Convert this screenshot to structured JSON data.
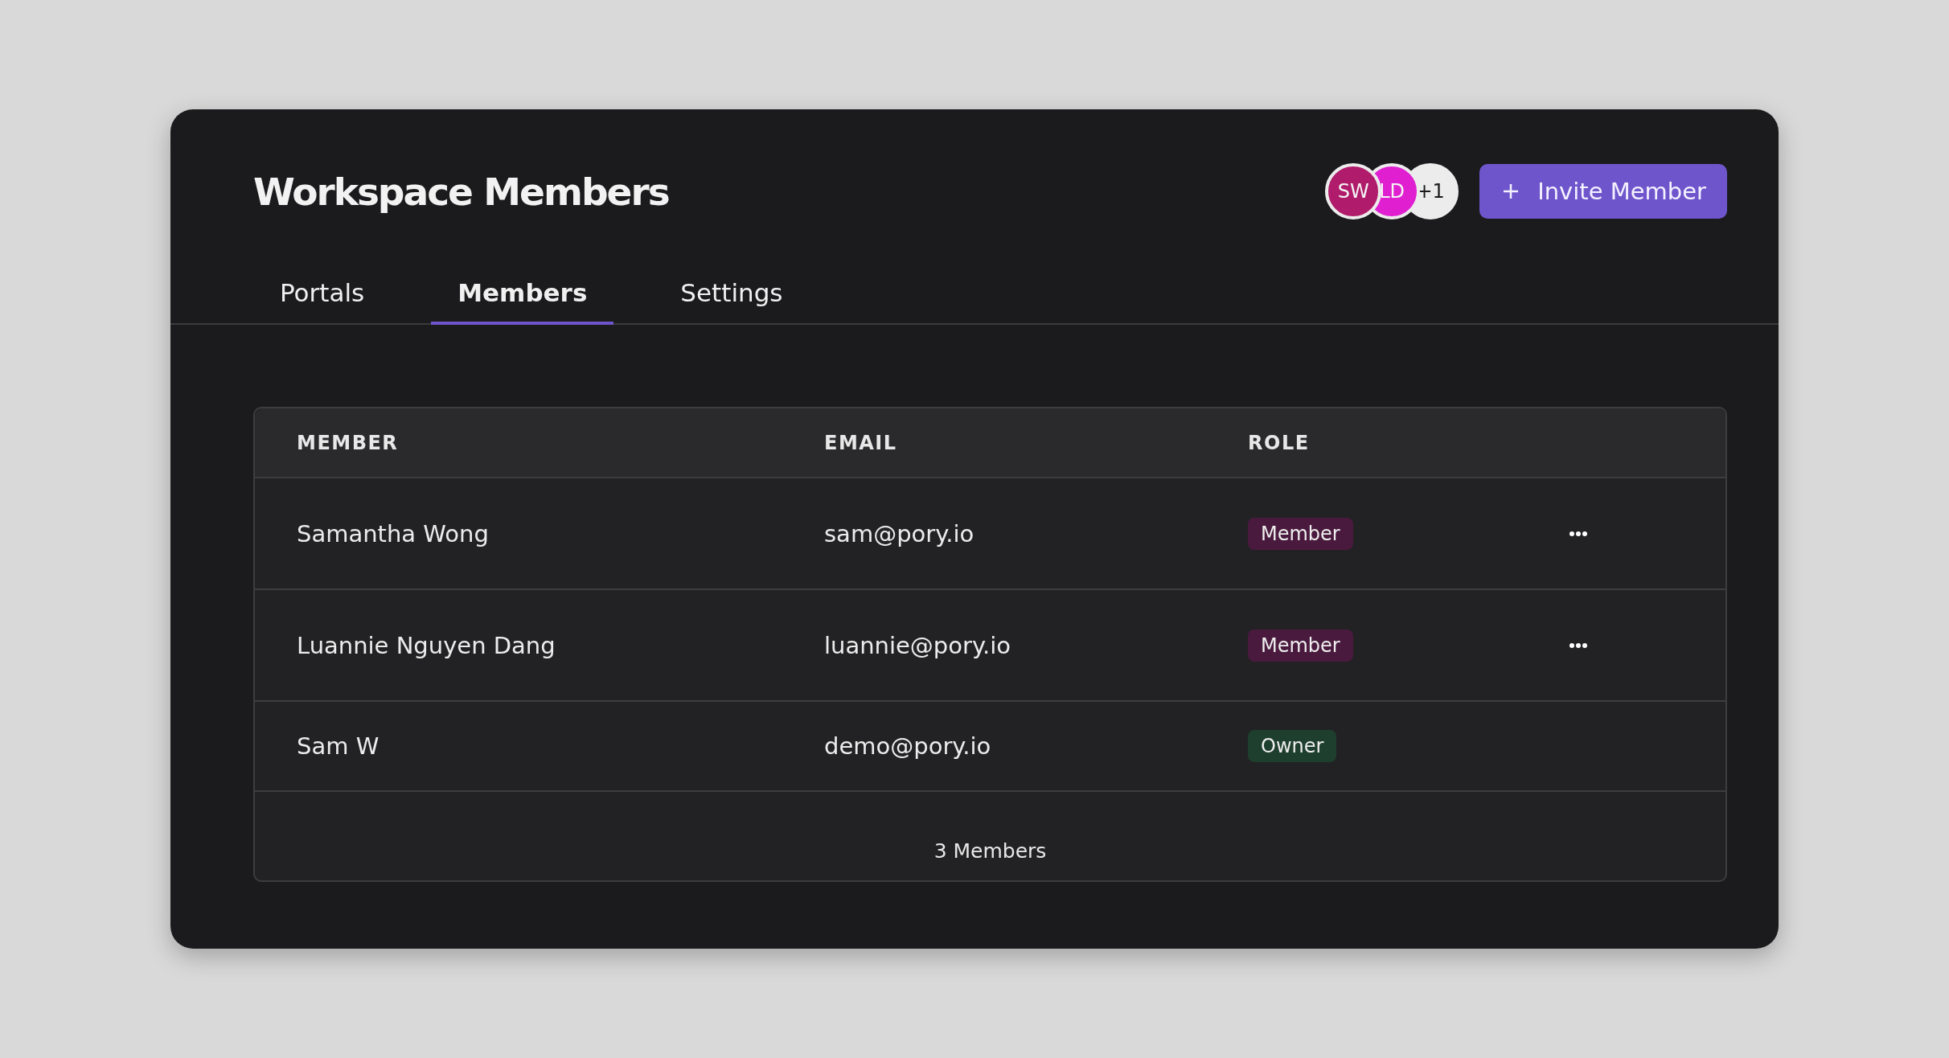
{
  "title": "Workspace Members",
  "avatars": [
    {
      "label": "SW",
      "kind": "person",
      "color": "#b01c6b"
    },
    {
      "label": "LD",
      "kind": "person",
      "color": "#e020d0"
    },
    {
      "label": "+1",
      "kind": "overflow",
      "color": "#ececec"
    }
  ],
  "invite_button": {
    "label": "Invite Member"
  },
  "tabs": [
    {
      "label": "Portals",
      "selected": false
    },
    {
      "label": "Members",
      "selected": true
    },
    {
      "label": "Settings",
      "selected": false
    }
  ],
  "table": {
    "columns": [
      "MEMBER",
      "EMAIL",
      "ROLE"
    ],
    "rows": [
      {
        "member": "Samantha Wong",
        "email": "sam@pory.io",
        "role": {
          "label": "Member",
          "color": "#4a1a3e"
        },
        "actions": true
      },
      {
        "member": "Luannie Nguyen Dang",
        "email": "luannie@pory.io",
        "role": {
          "label": "Member",
          "color": "#4a1a3e"
        },
        "actions": true
      },
      {
        "member": "Sam W",
        "email": "demo@pory.io",
        "role": {
          "label": "Owner",
          "color": "#1e3f2e"
        },
        "actions": false
      }
    ],
    "footer": "3 Members"
  }
}
